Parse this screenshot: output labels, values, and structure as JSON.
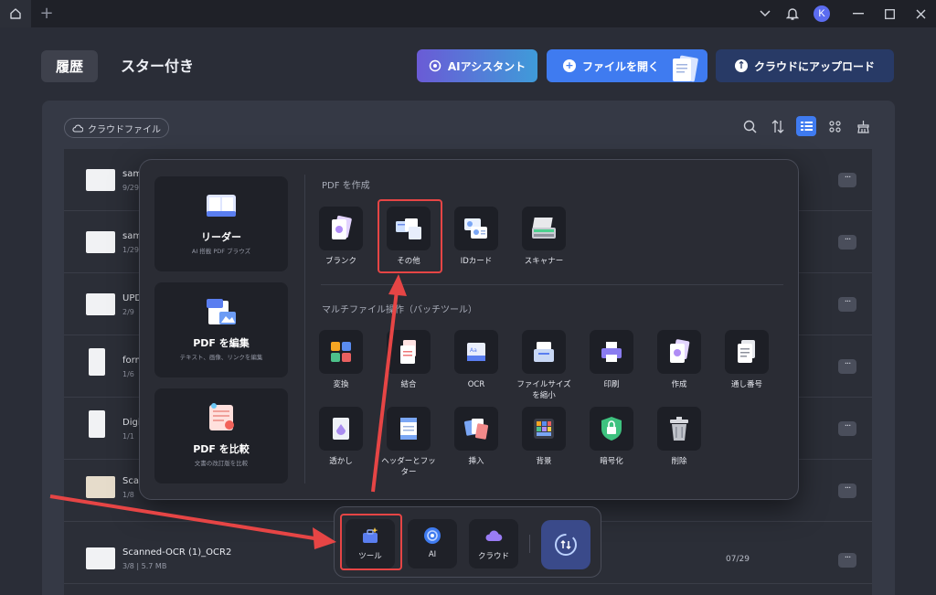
{
  "titlebar": {
    "avatar_initial": "K"
  },
  "header": {
    "tab_history": "履歴",
    "tab_starred": "スター付き",
    "ai_assistant": "AIアシスタント",
    "open_file": "ファイルを開く",
    "upload_cloud": "クラウドにアップロード"
  },
  "panel": {
    "cloud_files": "クラウドファイル"
  },
  "files": [
    {
      "name": "sam",
      "meta": "9/29"
    },
    {
      "name": "sam",
      "meta": "1/29"
    },
    {
      "name": "UPD",
      "meta": "2/9"
    },
    {
      "name": "form",
      "meta": "1/6"
    },
    {
      "name": "Digi",
      "meta": "1/1"
    },
    {
      "name": "Scan",
      "meta": "1/8"
    },
    {
      "name": "Scanned-OCR (1)_OCR2",
      "meta": "3/8 | 5.7 MB",
      "date": "07/29"
    }
  ],
  "popup": {
    "left_cards": [
      {
        "title": "リーダー",
        "subtitle": "AI 搭載 PDF ブラウズ"
      },
      {
        "title": "PDF を編集",
        "subtitle": "テキスト、画像、リンクを編集"
      },
      {
        "title": "PDF を比較",
        "subtitle": "文書の改訂版を比較"
      }
    ],
    "create_title": "PDF を作成",
    "create_tools": [
      "ブランク",
      "その他",
      "IDカード",
      "スキャナー"
    ],
    "batch_title": "マルチファイル操作（バッチツール）",
    "batch_tools_row1": [
      "変換",
      "結合",
      "OCR",
      "ファイルサイズを縮小",
      "印刷",
      "作成",
      "通し番号"
    ],
    "batch_tools_row2": [
      "透かし",
      "ヘッダーとフッター",
      "挿入",
      "背景",
      "暗号化",
      "削除"
    ]
  },
  "dock": {
    "tools": "ツール",
    "ai": "AI",
    "cloud": "クラウド"
  },
  "colors": {
    "accent": "#3f7bf0",
    "highlight": "#e64545",
    "background": "#2a2d37"
  }
}
